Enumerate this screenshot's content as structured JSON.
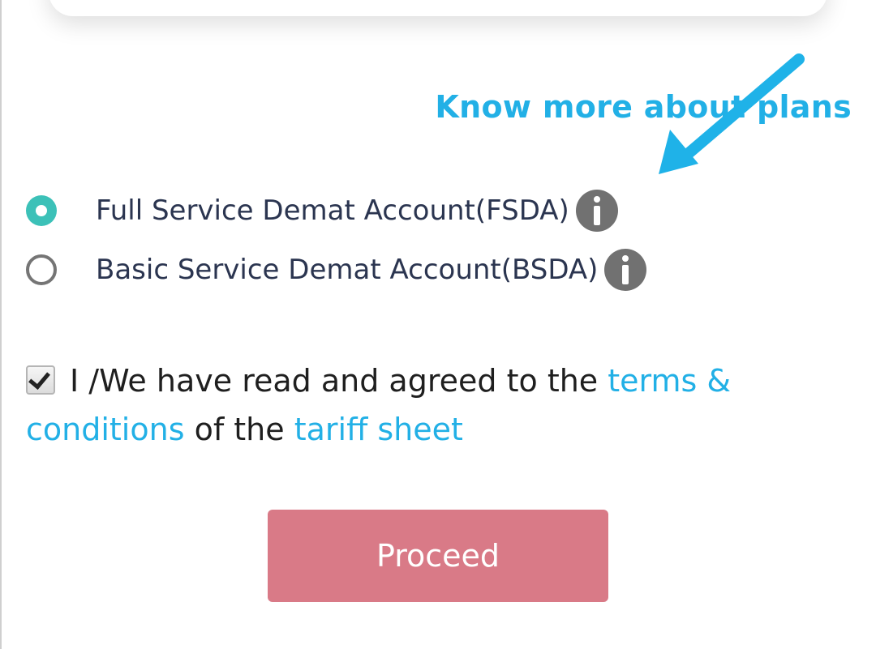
{
  "header": {
    "know_more_label": "Know more about plans"
  },
  "plans": [
    {
      "label": "Full Service Demat Account(FSDA)",
      "selected": true,
      "icon": "info-icon"
    },
    {
      "label": "Basic Service Demat Account(BSDA)",
      "selected": false,
      "icon": "info-icon"
    }
  ],
  "agreement": {
    "checked": true,
    "text_prefix": "I /We have read and agreed to the ",
    "terms_link": "terms & conditions",
    "text_middle": " of the ",
    "tariff_link": "tariff sheet"
  },
  "proceed_label": "Proceed",
  "colors": {
    "link": "#22b0e6",
    "arrow": "#1fb2e8",
    "radio_selected": "#3cc1b8",
    "proceed_button": "#d97a87",
    "info_icon": "#717171"
  },
  "annotation": {
    "icon": "arrow-pointer-icon"
  }
}
